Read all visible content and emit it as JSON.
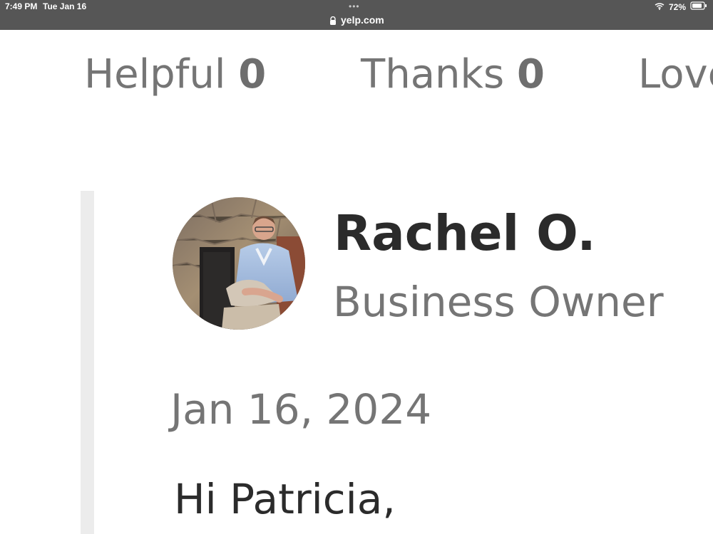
{
  "status_bar": {
    "time": "7:49 PM",
    "date": "Tue Jan 16",
    "url": "yelp.com",
    "battery": "72%",
    "icons": {
      "more": "dots-icon",
      "lock": "lock-icon",
      "wifi": "wifi-icon",
      "battery": "battery-icon"
    },
    "colors": {
      "background": "#565656",
      "text": "#ffffff"
    }
  },
  "reactions": [
    {
      "label": "Helpful",
      "count": "0"
    },
    {
      "label": "Thanks",
      "count": "0"
    },
    {
      "label": "Love",
      "count": ""
    }
  ],
  "reply": {
    "owner_name": "Rachel O.",
    "owner_role": "Business Owner",
    "date": "Jan 16, 2024",
    "greeting": "Hi Patricia,",
    "avatar_icon": "owner-avatar-photo",
    "colors": {
      "bar": "#ececec",
      "muted_text": "#757575",
      "primary_text": "#2b2b2b"
    }
  }
}
